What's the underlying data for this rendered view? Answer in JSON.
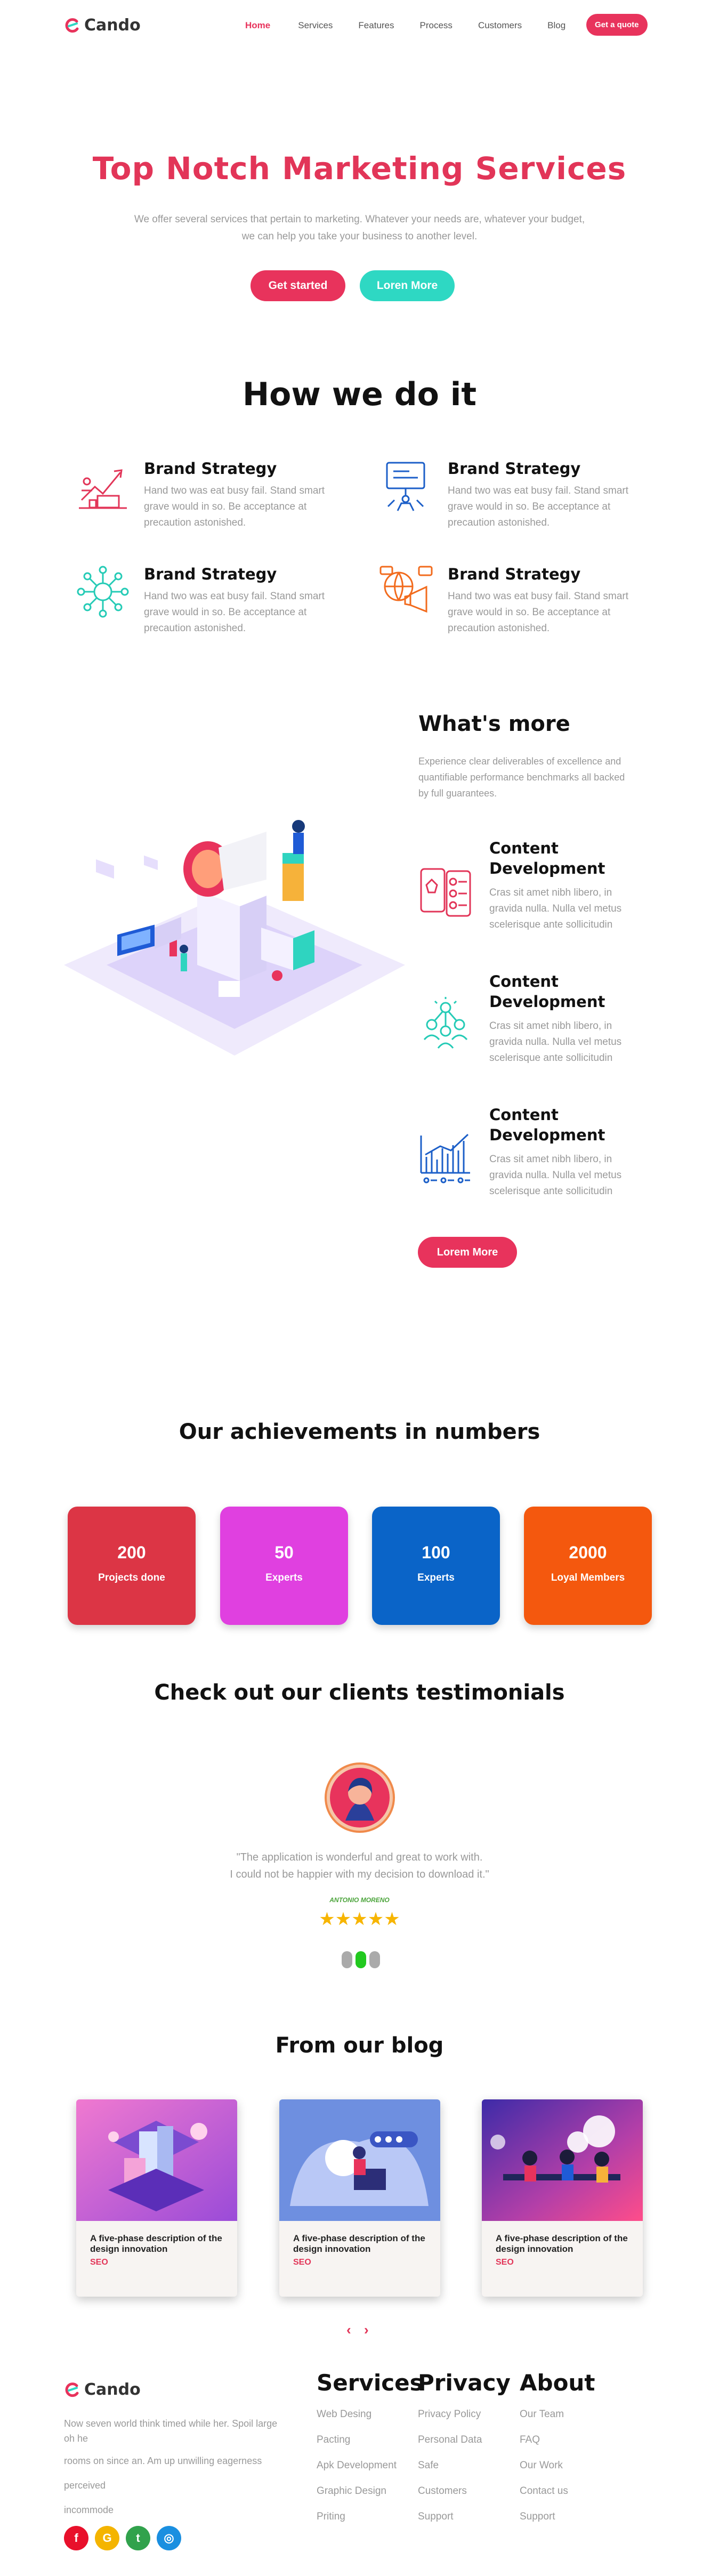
{
  "header": {
    "brand": "Cando",
    "nav": [
      "Home",
      "Services",
      "Features",
      "Process",
      "Customers",
      "Blog"
    ],
    "cta": "Get a quote"
  },
  "hero": {
    "title": "Top Notch Marketing Services",
    "subtitle_line1": "We offer several services that pertain to marketing. Whatever your needs are, whatever your budget,",
    "subtitle_line2": "we can help you take your business to another level.",
    "primary_button": "Get started",
    "secondary_button": "Loren More",
    "colors": {
      "primary": "#e8335c",
      "secondary": "#2ed8c3"
    }
  },
  "how": {
    "title": "How we do it",
    "items": [
      {
        "title": "Brand Strategy",
        "desc": [
          "Hand two was eat busy fail. Stand smart",
          "grave would in so. Be acceptance at",
          "precaution astonished."
        ],
        "icon": "chart-growth-icon"
      },
      {
        "title": "Brand Strategy",
        "desc": [
          "Hand two was eat busy fail. Stand smart",
          "grave would in so. Be acceptance at",
          "precaution astonished."
        ],
        "icon": "presentation-board-icon"
      },
      {
        "title": "Brand Strategy",
        "desc": [
          "Hand two was eat busy fail. Stand smart",
          "grave would in so. Be acceptance at",
          "precaution astonished."
        ],
        "icon": "network-hub-icon"
      },
      {
        "title": "Brand Strategy",
        "desc": [
          "Hand two was eat busy fail. Stand smart",
          "grave would in so. Be acceptance at",
          "precaution astonished."
        ],
        "icon": "globe-megaphone-icon"
      }
    ]
  },
  "more": {
    "title": "What's more",
    "intro": [
      "Experience clear deliverables of excellence and",
      "quantifiable performance benchmarks all backed",
      "by full guarantees."
    ],
    "items": [
      {
        "title": [
          "Content",
          "Development"
        ],
        "desc": [
          "Cras sit amet nibh libero, in",
          "gravida nulla. Nulla vel metus",
          "scelerisque ante sollicitudin"
        ],
        "icon": "checklist-icon"
      },
      {
        "title": [
          "Content",
          "Development"
        ],
        "desc": [
          "Cras sit amet nibh libero, in",
          "gravida nulla. Nulla vel metus",
          "scelerisque ante sollicitudin"
        ],
        "icon": "team-network-icon"
      },
      {
        "title": [
          "Content",
          "Development"
        ],
        "desc": [
          "Cras sit amet nibh libero, in",
          "gravida nulla. Nulla vel metus",
          "scelerisque ante sollicitudin"
        ],
        "icon": "bar-chart-icon"
      }
    ],
    "button": "Lorem More"
  },
  "achievements": {
    "title": "Our achievements in numbers",
    "stats": [
      {
        "value": "200",
        "label": "Projects done",
        "color": "#dc3545"
      },
      {
        "value": "50",
        "label": "Experts",
        "color": "#e040e0"
      },
      {
        "value": "100",
        "label": "Experts",
        "color": "#0a64c8"
      },
      {
        "value": "2000",
        "label": "Loyal Members",
        "color": "#f4580e"
      }
    ]
  },
  "testimonials": {
    "title": "Check out our clients testimonials",
    "quote_line1": "\"The application is wonderful and great to work with.",
    "quote_line2": "I could not be happier with my decision to download it.\"",
    "author": "ANTONIO MORENO",
    "rating": 5
  },
  "blog": {
    "title": "From our blog",
    "posts": [
      {
        "title_line1": "A five-phase description of the",
        "title_line2": "design innovation",
        "tag": "SEO"
      },
      {
        "title_line1": "A five-phase description of the",
        "title_line2": "design innovation",
        "tag": "SEO"
      },
      {
        "title_line1": "A five-phase description of the",
        "title_line2": "design innovation",
        "tag": "SEO"
      }
    ],
    "prev": "‹",
    "next": "›"
  },
  "footer": {
    "brand": "Cando",
    "about_lines": [
      "Now seven world think timed while her. Spoil large",
      "oh he",
      "rooms on since an. Am up unwilling eagerness",
      "perceived",
      "incommode"
    ],
    "columns": [
      {
        "heading": "Services",
        "links": [
          "Web Desing",
          "Pacting",
          "Apk Development",
          "Graphic Design",
          "Priting"
        ]
      },
      {
        "heading": "Privacy",
        "links": [
          "Privacy Policy",
          "Personal Data",
          "Safe",
          "Customers",
          "Support"
        ]
      },
      {
        "heading": "About",
        "links": [
          "Our Team",
          "FAQ",
          "Our Work",
          "Contact us",
          "Support"
        ]
      }
    ],
    "social": [
      {
        "icon": "facebook-icon",
        "glyph": "f",
        "color": "#e8102b"
      },
      {
        "icon": "google-icon",
        "glyph": "G",
        "color": "#f4b400"
      },
      {
        "icon": "twitter-icon",
        "glyph": "t",
        "color": "#31a24c"
      },
      {
        "icon": "instagram-icon",
        "glyph": "◎",
        "color": "#1a8fe0"
      }
    ]
  }
}
